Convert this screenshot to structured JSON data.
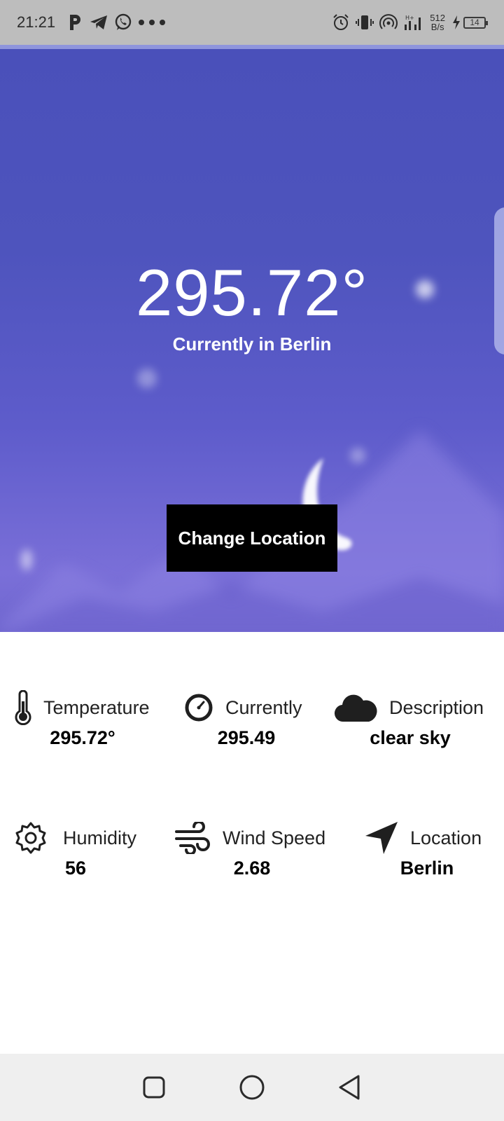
{
  "status_bar": {
    "time": "21:21",
    "net_speed_value": "512",
    "net_speed_unit": "B/s",
    "battery_level": "14"
  },
  "hero": {
    "temperature": "295.72°",
    "subtitle": "Currently in Berlin",
    "change_location_label": "Change Location",
    "background_color": "#5559c4"
  },
  "info": {
    "temperature": {
      "label": "Temperature",
      "value": "295.72°",
      "icon": "thermometer-icon"
    },
    "currently": {
      "label": "Currently",
      "value": "295.49",
      "icon": "gauge-icon"
    },
    "description": {
      "label": "Description",
      "value": "clear sky",
      "icon": "cloud-icon"
    },
    "humidity": {
      "label": "Humidity",
      "value": "56",
      "icon": "gear-icon"
    },
    "wind_speed": {
      "label": "Wind Speed",
      "value": "2.68",
      "icon": "wind-icon"
    },
    "location": {
      "label": "Location",
      "value": "Berlin",
      "icon": "navigation-arrow-icon"
    }
  },
  "nav_bar": {
    "recents_icon": "square-icon",
    "home_icon": "circle-icon",
    "back_icon": "triangle-back-icon"
  }
}
